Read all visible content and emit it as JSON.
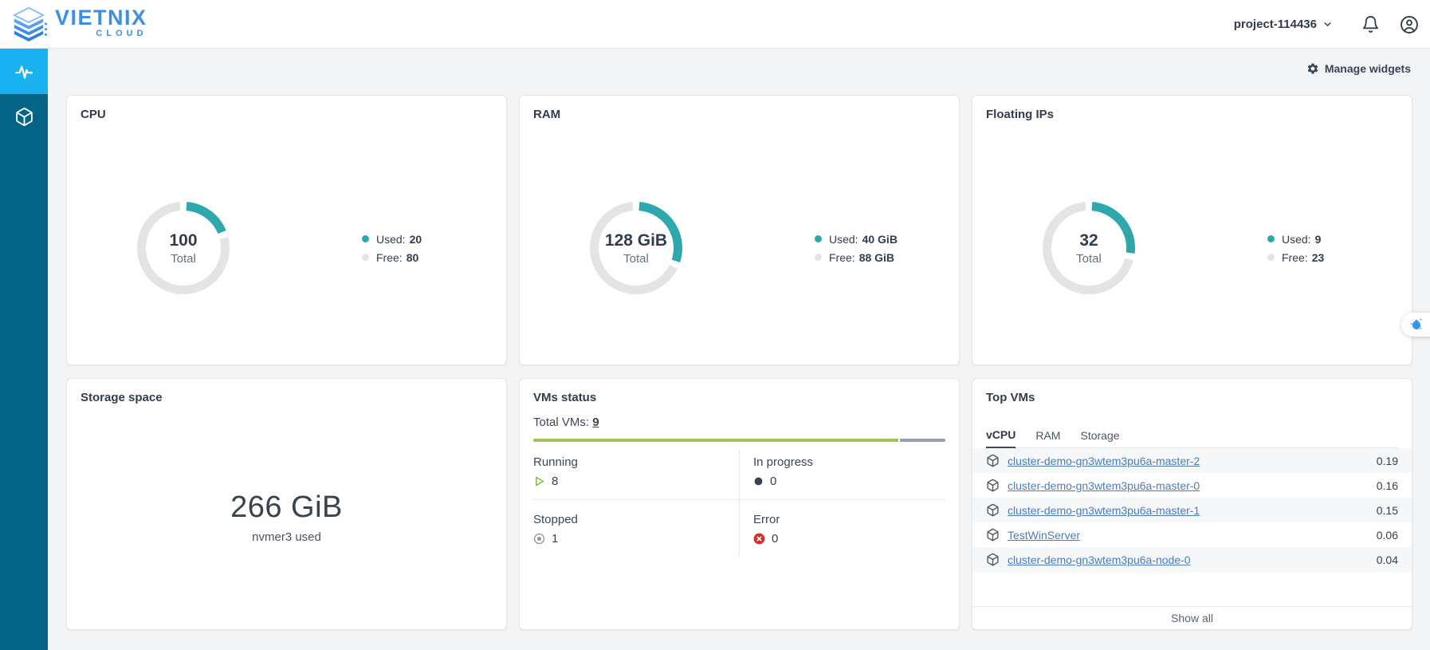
{
  "header": {
    "brand": {
      "name": "VIETNIX",
      "sub": "CLOUD"
    },
    "project_selector": {
      "label": "project-114436"
    }
  },
  "toolbar": {
    "manage_widgets_label": "Manage widgets"
  },
  "widgets": {
    "cpu": {
      "title": "CPU",
      "center_value": "100",
      "center_label": "Total",
      "donut": {
        "used": 20,
        "total": 100
      },
      "legend": {
        "used_label": "Used:",
        "used_value": "20",
        "free_label": "Free:",
        "free_value": "80"
      }
    },
    "ram": {
      "title": "RAM",
      "center_value": "128 GiB",
      "center_label": "Total",
      "donut": {
        "used": 40,
        "total": 128
      },
      "legend": {
        "used_label": "Used:",
        "used_value": "40 GiB",
        "free_label": "Free:",
        "free_value": "88 GiB"
      }
    },
    "floating_ips": {
      "title": "Floating IPs",
      "center_value": "32",
      "center_label": "Total",
      "donut": {
        "used": 9,
        "total": 32
      },
      "legend": {
        "used_label": "Used:",
        "used_value": "9",
        "free_label": "Free:",
        "free_value": "23"
      }
    },
    "storage": {
      "title": "Storage space",
      "value": "266 GiB",
      "caption": "nvmer3 used"
    },
    "vms_status": {
      "title": "VMs status",
      "total_label": "Total VMs:",
      "total_link": "9",
      "bar": {
        "running": 8,
        "total": 9
      },
      "cells": [
        {
          "label": "Running",
          "value": "8"
        },
        {
          "label": "In progress",
          "value": "0"
        },
        {
          "label": "Stopped",
          "value": "1"
        },
        {
          "label": "Error",
          "value": "0"
        }
      ]
    },
    "top_vms": {
      "title": "Top VMs",
      "tabs": [
        {
          "label": "vCPU"
        },
        {
          "label": "RAM"
        },
        {
          "label": "Storage"
        }
      ],
      "rows": [
        {
          "name": "cluster-demo-gn3wtem3pu6a-master-2",
          "value": "0.19"
        },
        {
          "name": "cluster-demo-gn3wtem3pu6a-master-0",
          "value": "0.16"
        },
        {
          "name": "cluster-demo-gn3wtem3pu6a-master-1",
          "value": "0.15"
        },
        {
          "name": "TestWinServer",
          "value": "0.06"
        },
        {
          "name": "cluster-demo-gn3wtem3pu6a-node-0",
          "value": "0.04"
        }
      ],
      "show_all_label": "Show all"
    }
  },
  "colors": {
    "accent_teal": "#2fa8ad",
    "track_gray": "#e2e4e6",
    "bar_green": "#a6c25a",
    "bar_gray": "#9aa0a7",
    "running_green": "#7eba44",
    "error_red": "#d32f2f",
    "sidebar": "#046487",
    "sidebar_active": "#1ab1f0",
    "brand_blue": "#3d8fe2",
    "link_blue": "#4a7cbe"
  },
  "chart_data": [
    {
      "type": "pie",
      "title": "CPU",
      "categories": [
        "Used",
        "Free"
      ],
      "values": [
        20,
        80
      ],
      "total_label": "100 Total"
    },
    {
      "type": "pie",
      "title": "RAM",
      "categories": [
        "Used",
        "Free"
      ],
      "values": [
        40,
        88
      ],
      "total_label": "128 GiB Total"
    },
    {
      "type": "pie",
      "title": "Floating IPs",
      "categories": [
        "Used",
        "Free"
      ],
      "values": [
        9,
        23
      ],
      "total_label": "32 Total"
    },
    {
      "type": "bar",
      "title": "VMs status",
      "categories": [
        "Running",
        "In progress",
        "Stopped",
        "Error"
      ],
      "values": [
        8,
        0,
        1,
        0
      ],
      "total": 9
    }
  ]
}
